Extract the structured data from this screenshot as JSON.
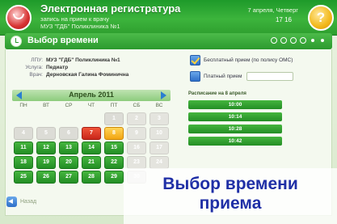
{
  "header": {
    "title": "Электронная регистратура",
    "subtitle1": "запись на прием к врачу",
    "subtitle2": "МУЗ \"ГДБ\" Поликлиника №1",
    "date": "7 апреля, Четверг",
    "time": "17  16",
    "help_label": "?"
  },
  "section": {
    "title": "Выбор времени",
    "steps_done": 4,
    "steps_future": 2
  },
  "info": {
    "lpu_key": "ЛПУ:",
    "lpu_val": "МУЗ \"ГДБ\" Поликлиника №1",
    "service_key": "Услуга:",
    "service_val": "Педиатр",
    "doctor_key": "Врач:",
    "doctor_val": "Дерновская Галина Фоминична"
  },
  "options": {
    "free_label": "Бесплатный прием (по полису ОМС)",
    "paid_label": "Платный прием"
  },
  "calendar": {
    "month": "Апрель 2011",
    "weekdays": [
      "ПН",
      "ВТ",
      "СР",
      "ЧТ",
      "ПТ",
      "СБ",
      "ВС"
    ],
    "days": [
      {
        "n": "",
        "s": "empty"
      },
      {
        "n": "",
        "s": "empty"
      },
      {
        "n": "",
        "s": "empty"
      },
      {
        "n": "",
        "s": "empty"
      },
      {
        "n": "1",
        "s": "past"
      },
      {
        "n": "2",
        "s": "wknd"
      },
      {
        "n": "3",
        "s": "wknd"
      },
      {
        "n": "4",
        "s": "past"
      },
      {
        "n": "5",
        "s": "past"
      },
      {
        "n": "6",
        "s": "past"
      },
      {
        "n": "7",
        "s": "today"
      },
      {
        "n": "8",
        "s": "selected"
      },
      {
        "n": "9",
        "s": "wknd"
      },
      {
        "n": "10",
        "s": "wknd"
      },
      {
        "n": "11",
        "s": "avail"
      },
      {
        "n": "12",
        "s": "avail"
      },
      {
        "n": "13",
        "s": "avail"
      },
      {
        "n": "14",
        "s": "avail"
      },
      {
        "n": "15",
        "s": "avail"
      },
      {
        "n": "16",
        "s": "wknd"
      },
      {
        "n": "17",
        "s": "wknd"
      },
      {
        "n": "18",
        "s": "avail"
      },
      {
        "n": "19",
        "s": "avail"
      },
      {
        "n": "20",
        "s": "avail"
      },
      {
        "n": "21",
        "s": "avail"
      },
      {
        "n": "22",
        "s": "avail"
      },
      {
        "n": "23",
        "s": "wknd"
      },
      {
        "n": "24",
        "s": "wknd"
      },
      {
        "n": "25",
        "s": "avail"
      },
      {
        "n": "26",
        "s": "avail"
      },
      {
        "n": "27",
        "s": "avail"
      },
      {
        "n": "28",
        "s": "avail"
      },
      {
        "n": "29",
        "s": "avail"
      },
      {
        "n": "30",
        "s": "wknd"
      },
      {
        "n": "",
        "s": "empty"
      }
    ]
  },
  "schedule": {
    "title": "Расписание на 8 апреля",
    "slots": [
      "10:00",
      "10:14",
      "10:28",
      "10:42"
    ]
  },
  "footer": {
    "back_label": "Назад"
  },
  "caption": {
    "line1": "Выбор времени",
    "line2": "приема"
  },
  "colors": {
    "brand_green": "#2e9e2e",
    "accent_blue": "#2e6fc8",
    "today_red": "#d73232",
    "selected_yellow": "#f2b81a",
    "caption_blue": "#1f2fa6"
  }
}
